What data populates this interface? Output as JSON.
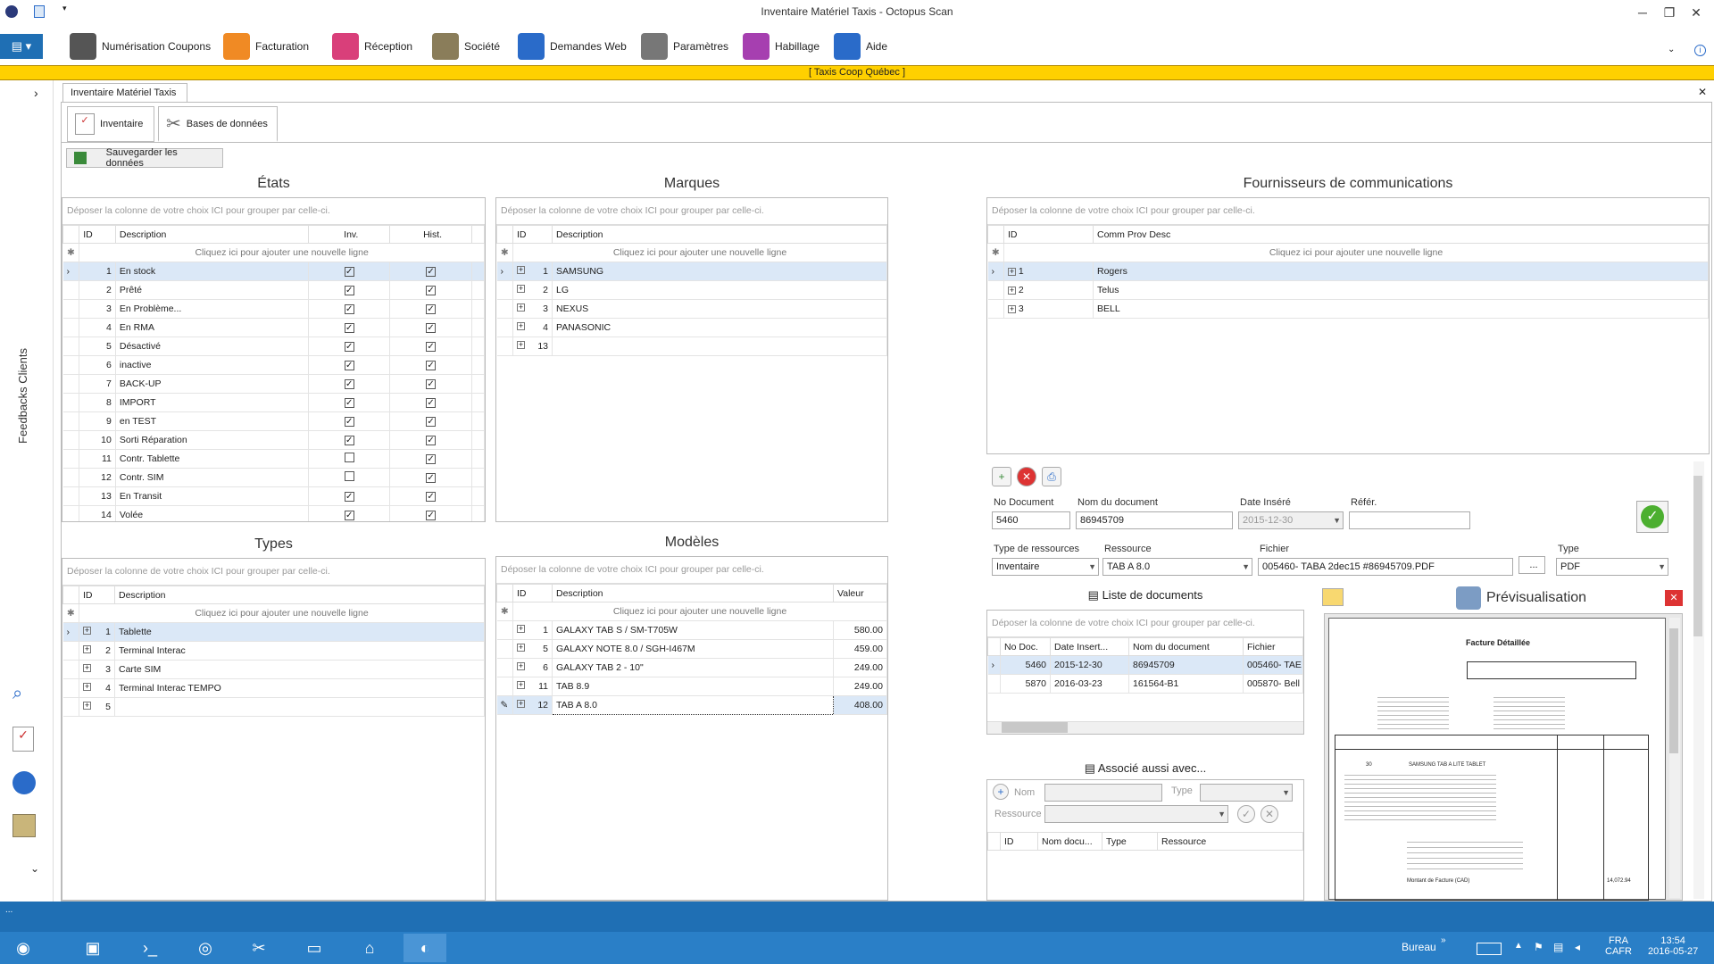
{
  "window": {
    "title": "Inventaire Matériel Taxis - Octopus Scan"
  },
  "ribbon": {
    "items": [
      {
        "label": "Numérisation Coupons",
        "icon": "scanner-icon",
        "color": "#555"
      },
      {
        "label": "Facturation",
        "icon": "invoice-icon",
        "color": "#f08a24"
      },
      {
        "label": "Réception",
        "icon": "house-icon",
        "color": "#d93f7a"
      },
      {
        "label": "Société",
        "icon": "building-icon",
        "color": "#8a7d5a"
      },
      {
        "label": "Demandes Web",
        "icon": "globe-icon",
        "color": "#2a6bc9"
      },
      {
        "label": "Paramètres",
        "icon": "tools-icon",
        "color": "#777"
      },
      {
        "label": "Habillage",
        "icon": "palette-icon",
        "color": "#a63fb0"
      },
      {
        "label": "Aide",
        "icon": "help-icon",
        "color": "#2a6bc9"
      }
    ]
  },
  "banner": {
    "company": "[   Taxis Coop Québec   ]"
  },
  "sidebar": {
    "label": "Feedbacks Clients"
  },
  "doc_tab": {
    "label": "Inventaire Matériel Taxis"
  },
  "subtabs": {
    "inventaire": "Inventaire",
    "bases": "Bases de données"
  },
  "save_button": "Sauvegarder les données",
  "group_hint": "Déposer la colonne de votre choix ICI pour grouper par celle-ci.",
  "add_row": "Cliquez ici pour ajouter une nouvelle ligne",
  "etats": {
    "title": "États",
    "cols": [
      "ID",
      "Description",
      "Inv.",
      "Hist."
    ],
    "rows": [
      {
        "id": "1",
        "desc": "En stock",
        "inv": true,
        "hist": true
      },
      {
        "id": "2",
        "desc": "Prêté",
        "inv": true,
        "hist": true
      },
      {
        "id": "3",
        "desc": "En Problème...",
        "inv": true,
        "hist": true
      },
      {
        "id": "4",
        "desc": "En RMA",
        "inv": true,
        "hist": true
      },
      {
        "id": "5",
        "desc": "Désactivé",
        "inv": true,
        "hist": true
      },
      {
        "id": "6",
        "desc": "inactive",
        "inv": true,
        "hist": true
      },
      {
        "id": "7",
        "desc": "BACK-UP",
        "inv": true,
        "hist": true
      },
      {
        "id": "8",
        "desc": "IMPORT",
        "inv": true,
        "hist": true
      },
      {
        "id": "9",
        "desc": "en TEST",
        "inv": true,
        "hist": true
      },
      {
        "id": "10",
        "desc": "Sorti Réparation",
        "inv": true,
        "hist": true
      },
      {
        "id": "11",
        "desc": "Contr. Tablette",
        "inv": false,
        "hist": true
      },
      {
        "id": "12",
        "desc": "Contr. SIM",
        "inv": false,
        "hist": true
      },
      {
        "id": "13",
        "desc": "En Transit",
        "inv": true,
        "hist": true
      },
      {
        "id": "14",
        "desc": "Volée",
        "inv": true,
        "hist": true
      }
    ]
  },
  "marques": {
    "title": "Marques",
    "cols": [
      "ID",
      "Description"
    ],
    "rows": [
      {
        "id": "1",
        "desc": "SAMSUNG"
      },
      {
        "id": "2",
        "desc": "LG"
      },
      {
        "id": "3",
        "desc": "NEXUS"
      },
      {
        "id": "4",
        "desc": "PANASONIC"
      },
      {
        "id": "13",
        "desc": ""
      }
    ]
  },
  "fournisseurs": {
    "title": "Fournisseurs de communications",
    "cols": [
      "ID",
      "Comm Prov Desc"
    ],
    "rows": [
      {
        "id": "1",
        "desc": "Rogers"
      },
      {
        "id": "2",
        "desc": "Telus"
      },
      {
        "id": "3",
        "desc": "BELL"
      }
    ]
  },
  "types": {
    "title": "Types",
    "cols": [
      "ID",
      "Description"
    ],
    "rows": [
      {
        "id": "1",
        "desc": "Tablette"
      },
      {
        "id": "2",
        "desc": "Terminal Interac"
      },
      {
        "id": "3",
        "desc": "Carte SIM"
      },
      {
        "id": "4",
        "desc": "Terminal Interac TEMPO"
      },
      {
        "id": "5",
        "desc": ""
      }
    ]
  },
  "modeles": {
    "title": "Modèles",
    "cols": [
      "ID",
      "Description",
      "Valeur"
    ],
    "rows": [
      {
        "id": "1",
        "desc": "GALAXY TAB S / SM-T705W",
        "val": "580.00"
      },
      {
        "id": "5",
        "desc": "GALAXY NOTE 8.0 / SGH-I467M",
        "val": "459.00"
      },
      {
        "id": "6",
        "desc": "GALAXY TAB 2 - 10\"",
        "val": "249.00"
      },
      {
        "id": "11",
        "desc": "TAB 8.9",
        "val": "249.00"
      },
      {
        "id": "12",
        "desc": "TAB A 8.0",
        "val": "408.00"
      }
    ]
  },
  "document": {
    "labels": {
      "no": "No Document",
      "nom": "Nom du document",
      "date": "Date Inséré",
      "ref": "Référ.",
      "type_res": "Type de ressources",
      "res": "Ressource",
      "fichier": "Fichier",
      "type": "Type"
    },
    "values": {
      "no": "5460",
      "nom": "86945709",
      "date": "2015-12-30",
      "ref": "",
      "type_res": "Inventaire",
      "res": "TAB A 8.0",
      "fichier": "005460- TABA 2dec15 #86945709.PDF",
      "type": "PDF"
    }
  },
  "liste_docs": {
    "title": "Liste de documents",
    "cols": [
      "No Doc.",
      "Date Insert...",
      "Nom du document",
      "Fichier"
    ],
    "rows": [
      {
        "no": "5460",
        "date": "2015-12-30",
        "nom": "86945709",
        "f": "005460- TAE"
      },
      {
        "no": "5870",
        "date": "2016-03-23",
        "nom": "161564-B1",
        "f": "005870- Bell"
      }
    ]
  },
  "associe": {
    "title": "Associé aussi avec...",
    "nom": "Nom",
    "type": "Type",
    "ressource": "Ressource",
    "cols": [
      "ID",
      "Nom docu...",
      "Type",
      "Ressource"
    ]
  },
  "preview": {
    "title": "Prévisualisation",
    "doc_title": "Facture Détaillée",
    "doc_line": "SAMSUNG TAB A LITE TABLET",
    "total_label": "Montant de Facture (CAD)",
    "total": "14,072.94"
  },
  "taskbar": {
    "lang": "FRA",
    "layout": "CAFR",
    "time": "13:54",
    "date": "2016-05-27",
    "bureau": "Bureau"
  }
}
